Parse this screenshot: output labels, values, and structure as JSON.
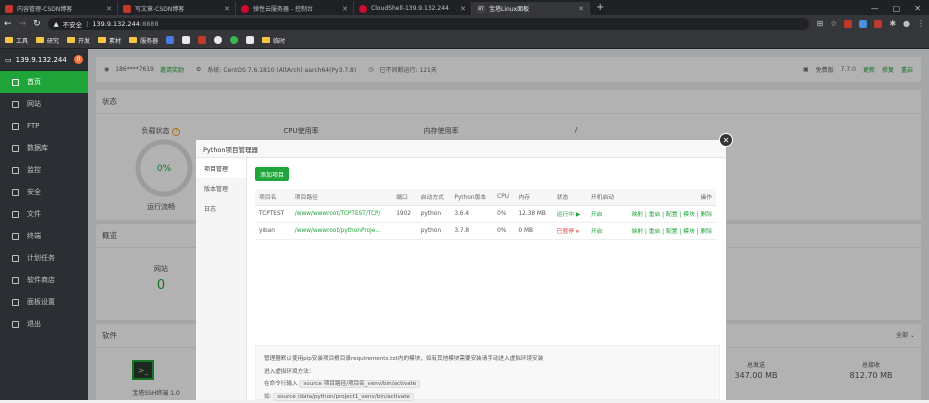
{
  "browser": {
    "tabs": [
      {
        "title": "内容管理-CSDN博客",
        "icon": "csdn-icon"
      },
      {
        "title": "写文章-CSDN博客",
        "icon": "csdn-icon"
      },
      {
        "title": "弹性云服务器 - 控制台",
        "icon": "huawei-icon"
      },
      {
        "title": "CloudShell-139.9.132.244",
        "icon": "huawei-icon"
      },
      {
        "title": "宝塔Linux面板",
        "icon": "bt-icon",
        "active": true
      }
    ],
    "new_tab": "+",
    "address": {
      "security": "不安全",
      "host": "139.9.132.244",
      "port": ":8888"
    },
    "bookmarks": [
      {
        "label": "工具",
        "type": "folder"
      },
      {
        "label": "研究",
        "type": "folder"
      },
      {
        "label": "开发",
        "type": "folder"
      },
      {
        "label": "素材",
        "type": "folder"
      },
      {
        "label": "服务器",
        "type": "folder"
      },
      {
        "label": "",
        "type": "icon"
      },
      {
        "label": "",
        "type": "icon"
      },
      {
        "label": "",
        "type": "icon"
      },
      {
        "label": "",
        "type": "icon"
      },
      {
        "label": "",
        "type": "icon"
      },
      {
        "label": "",
        "type": "icon"
      },
      {
        "label": "临时",
        "type": "folder"
      }
    ]
  },
  "sidebar": {
    "server": "139.9.132.244",
    "badge": "0",
    "items": [
      {
        "label": "首页",
        "active": true
      },
      {
        "label": "网站"
      },
      {
        "label": "FTP"
      },
      {
        "label": "数据库"
      },
      {
        "label": "监控"
      },
      {
        "label": "安全"
      },
      {
        "label": "文件"
      },
      {
        "label": "终端"
      },
      {
        "label": "计划任务"
      },
      {
        "label": "软件商店"
      },
      {
        "label": "面板设置"
      },
      {
        "label": "退出"
      }
    ]
  },
  "topbar": {
    "user": "186****7619",
    "verify": "邀请奖励",
    "system": "系统: CentOS 7.6.1810 (AltArch) aarch64(Py3.7.8)",
    "uptime": "已不间断运行: 121天",
    "edition": "免费版",
    "version": "7.7.0",
    "update": "更新",
    "repair": "修复",
    "restart": "重启"
  },
  "status": {
    "title": "状态",
    "load_label": "负载状态",
    "load_value": "0%",
    "load_state": "运行流畅",
    "cpu_label": "CPU使用率",
    "mem_label": "内存使用率",
    "disk_label": "/"
  },
  "overview": {
    "title": "概览",
    "site_label": "网站",
    "site_value": "0"
  },
  "software": {
    "title": "软件",
    "filter": "全部",
    "ssh_label": "宝塔SSH终端 1.0",
    "stats": [
      {
        "label": "总发送",
        "value": "347.00 MB"
      },
      {
        "label": "总接收",
        "value": "812.70 MB"
      }
    ]
  },
  "modal": {
    "title": "Python项目管理器",
    "nav": [
      "项目管理",
      "版本管理",
      "日志"
    ],
    "add_button": "添加项目",
    "columns": [
      "项目名",
      "项目路径",
      "端口",
      "启动方式",
      "Python版本",
      "CPU",
      "内存",
      "状态",
      "开机启动",
      "操作"
    ],
    "rows": [
      {
        "name": "TCPTEST",
        "path": "/www/wwwroot/TCPTEST/TCP/",
        "port": "1902",
        "mode": "python",
        "pyver": "3.6.4",
        "cpu": "0%",
        "mem": "12.38 MB",
        "status": "运行中 ▶",
        "status_type": "run",
        "autostart": "开启",
        "ops": "映射 | 重启 | 配置 | 模块 | 删除"
      },
      {
        "name": "yiban",
        "path": "/www/wwwroot/pythonProje...",
        "port": "",
        "mode": "python",
        "pyver": "3.7.8",
        "cpu": "0%",
        "mem": "0 MB",
        "status": "已暂停 ⏸",
        "status_type": "stop",
        "autostart": "开启",
        "ops": "映射 | 重启 | 配置 | 模块 | 删除"
      }
    ],
    "tips": {
      "line1": "管理器默认使用pip安装项目根目录requirements.txt内的模块，如有其他模块需要安装请手动进入虚拟环境安装",
      "line2": "进入虚拟环境方法：",
      "line3_prefix": "在命令行输入",
      "line3_code": "source 项目路径/项目名_venv/bin/activate",
      "line4_prefix": "如:",
      "line4_code": "source /data/python/project1_venv/bin/activate"
    }
  }
}
